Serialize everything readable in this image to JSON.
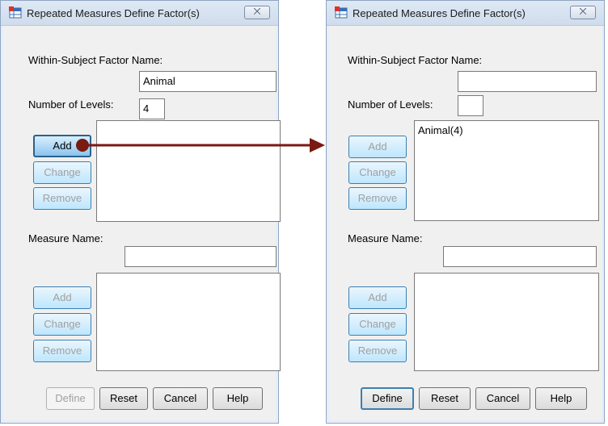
{
  "left_dialog": {
    "title": "Repeated Measures Define Factor(s)",
    "close_symbol": "⨉",
    "factor_name_label": "Within-Subject Factor Name:",
    "factor_name_value": "Animal",
    "levels_label": "Number of Levels:",
    "levels_value": "4",
    "factor_add": "Add",
    "factor_change": "Change",
    "factor_remove": "Remove",
    "factor_list_item": "",
    "measure_label": "Measure Name:",
    "measure_value": "",
    "measure_add": "Add",
    "measure_change": "Change",
    "measure_remove": "Remove",
    "define": "Define",
    "reset": "Reset",
    "cancel": "Cancel",
    "help": "Help"
  },
  "right_dialog": {
    "title": "Repeated Measures Define Factor(s)",
    "close_symbol": "⨉",
    "factor_name_label": "Within-Subject Factor Name:",
    "factor_name_value": "",
    "levels_label": "Number of Levels:",
    "levels_value": "",
    "factor_add": "Add",
    "factor_change": "Change",
    "factor_remove": "Remove",
    "factor_list_item": "Animal(4)",
    "measure_label": "Measure Name:",
    "measure_value": "",
    "measure_add": "Add",
    "measure_change": "Change",
    "measure_remove": "Remove",
    "define": "Define",
    "reset": "Reset",
    "cancel": "Cancel",
    "help": "Help"
  },
  "colors": {
    "arrow": "#7a1a12",
    "accent": "#3c7fb1"
  },
  "icons": {
    "app": "spss-table-icon",
    "close": "close-icon"
  }
}
